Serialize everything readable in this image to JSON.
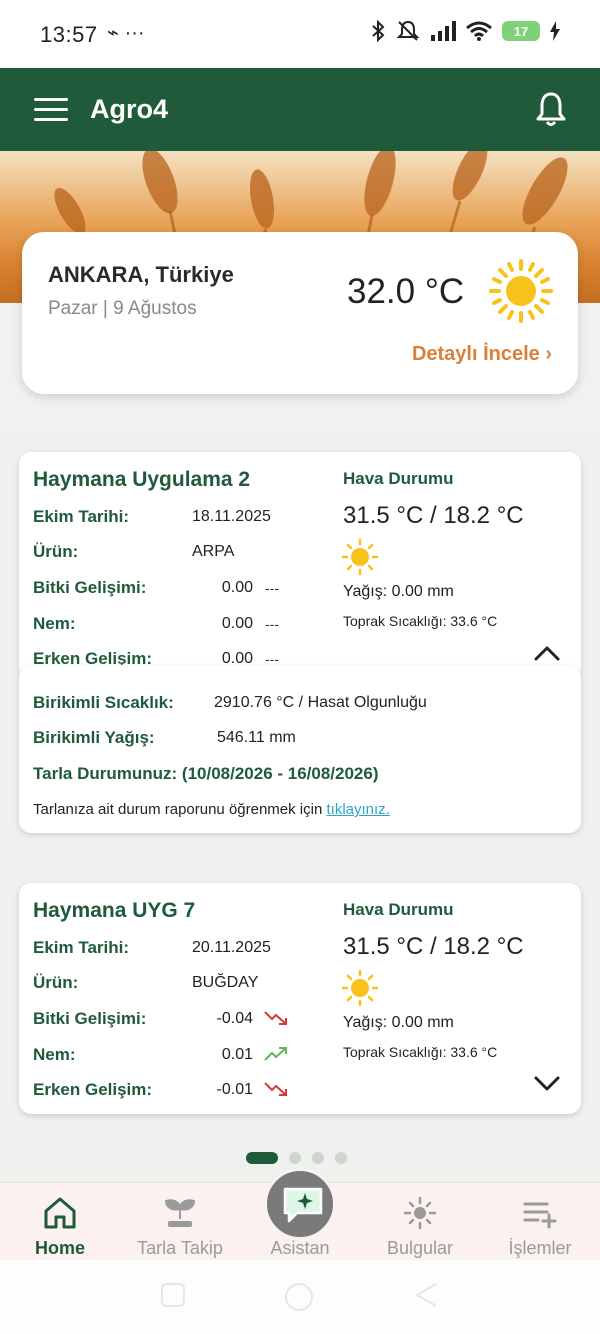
{
  "status_bar": {
    "time": "13:57",
    "extra": "⌁ ···",
    "battery": "17",
    "icons": [
      "bluetooth-icon",
      "mute-icon",
      "signal-icon",
      "wifi-icon",
      "battery-icon",
      "charging-icon"
    ]
  },
  "app_bar": {
    "title": "Agro4"
  },
  "weather": {
    "city": "ANKARA, Türkiye",
    "date": "Pazar | 9 Ağustos",
    "temperature": "32.0 °C",
    "detail_link": "Detaylı İncele ›",
    "icon": "sun-icon"
  },
  "fields": [
    {
      "name": "Haymana Uygulama 2",
      "rows": [
        {
          "label": "Ekim Tarihi:",
          "value": "18.11.2025"
        },
        {
          "label": "Ürün:",
          "value": "ARPA"
        },
        {
          "label": "Bitki Gelişimi:",
          "value": "0.00",
          "trend": "---"
        },
        {
          "label": "Nem:",
          "value": "0.00",
          "trend": "---"
        },
        {
          "label": "Erken Gelişim:",
          "value": "0.00",
          "trend": "---"
        }
      ],
      "weather_title": "Hava Durumu",
      "weather_temp": "31.5 °C / 18.2 °C",
      "rain": "Yağış: 0.00 mm",
      "soil": "Toprak Sıcaklığı: 33.6 °C",
      "expanded": true
    },
    {
      "name": "Haymana UYG 7",
      "rows": [
        {
          "label": "Ekim Tarihi:",
          "value": "20.11.2025"
        },
        {
          "label": "Ürün:",
          "value": "BUĞDAY"
        },
        {
          "label": "Bitki Gelişimi:",
          "value": "-0.04",
          "trend": "down"
        },
        {
          "label": "Nem:",
          "value": "0.01",
          "trend": "up"
        },
        {
          "label": "Erken Gelişim:",
          "value": "-0.01",
          "trend": "down"
        }
      ],
      "weather_title": "Hava Durumu",
      "weather_temp": "31.5 °C / 18.2 °C",
      "rain": "Yağış: 0.00 mm",
      "soil": "Toprak Sıcaklığı: 33.6 °C",
      "expanded": false
    }
  ],
  "expanded_details": {
    "cum_temp_label": "Birikimli Sıcaklık:",
    "cum_temp_value": "2910.76 °C / Hasat Olgunluğu",
    "cum_rain_label": "Birikimli Yağış:",
    "cum_rain_value": "546.11 mm",
    "field_status": "Tarla Durumunuz: (10/08/2026 - 16/08/2026)",
    "report_text": "Tarlanıza ait durum raporunu öğrenmek için ",
    "report_link": "tıklayınız."
  },
  "pager": {
    "count": 4,
    "active_index": 0
  },
  "bottom_nav": [
    {
      "label": "Home",
      "icon": "home-icon",
      "active": true
    },
    {
      "label": "Tarla Takip",
      "icon": "sprout-icon",
      "active": false
    },
    {
      "label": "Asistan",
      "icon": "chat-sparkle-icon",
      "active": false
    },
    {
      "label": "Bulgular",
      "icon": "bug-icon",
      "active": false
    },
    {
      "label": "İşlemler",
      "icon": "list-add-icon",
      "active": false
    }
  ],
  "colors": {
    "primary": "#1f5b3a",
    "accent": "#d9803b",
    "link": "#2aa6c9",
    "trend_down": "#d23a3a",
    "trend_up": "#5cb85c",
    "sun": "#f7c21c"
  }
}
